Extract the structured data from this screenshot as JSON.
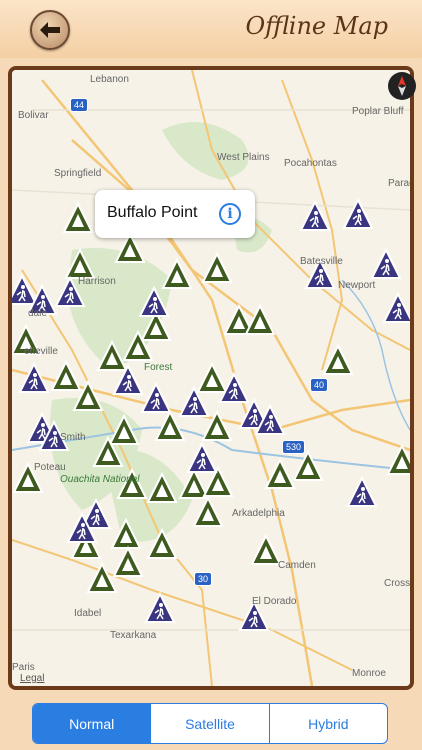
{
  "header": {
    "title": "Offline Map",
    "back_icon": "back-arrow-icon"
  },
  "callout": {
    "title": "Buffalo Point",
    "info_icon": "i"
  },
  "compass_icon": "compass-icon",
  "legal_label": "Legal",
  "view_modes": [
    "Normal",
    "Satellite",
    "Hybrid"
  ],
  "selected_view_mode": "Normal",
  "place_labels": [
    "Lebanon",
    "Bolivar",
    "Springfield",
    "West Plains",
    "Pocahontas",
    "Poplar Bluff",
    "Parag",
    "Harrison",
    "Batesville",
    "Newport",
    "dale",
    "etteville",
    "Forest",
    "Smith",
    "Poteau",
    "Ouachita National",
    "Arkadelphia",
    "Camden",
    "El Dorado",
    "Idabel",
    "Texarkana",
    "Paris",
    "Monroe",
    "Cross"
  ],
  "highway_labels": [
    "44",
    "40",
    "530",
    "30"
  ],
  "colors": {
    "campground_marker": "#3e5a1e",
    "hiking_marker": "#3a3580",
    "accent": "#2a7de1"
  }
}
